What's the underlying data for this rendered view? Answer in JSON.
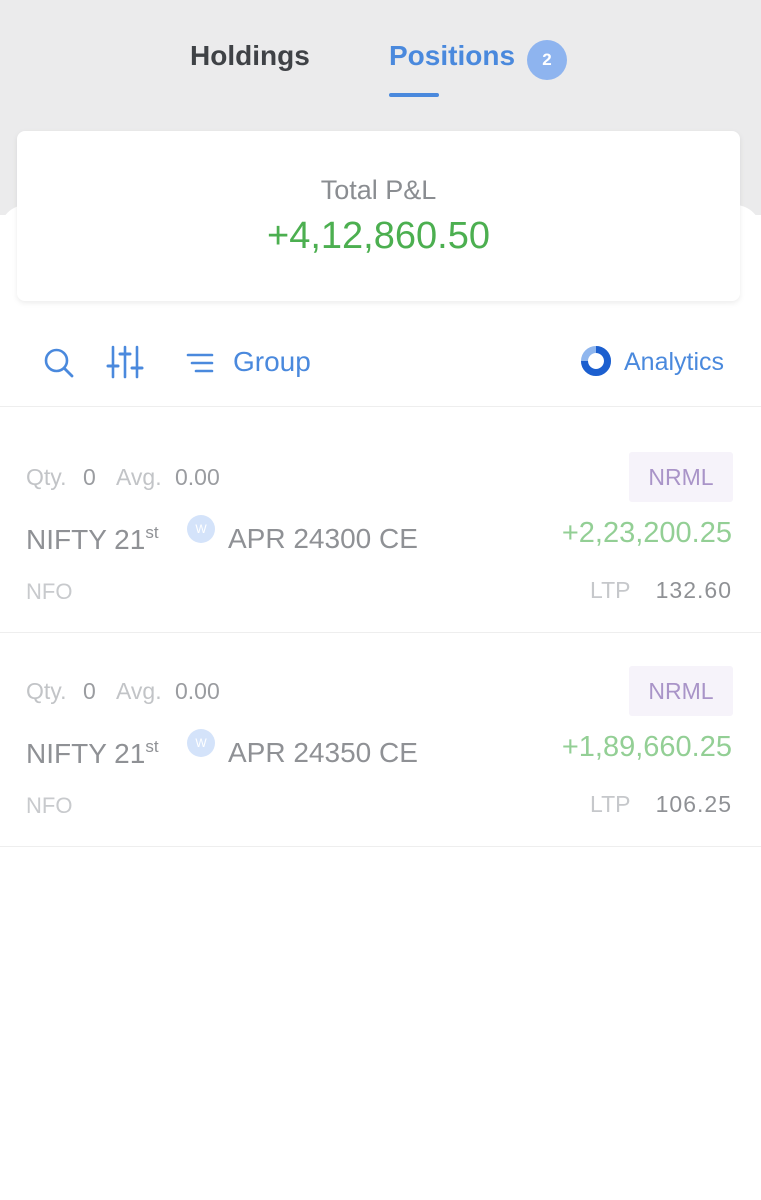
{
  "tabs": {
    "holdings_label": "Holdings",
    "positions_label": "Positions",
    "positions_count": "2"
  },
  "summary": {
    "label": "Total P&L",
    "value": "+4,12,860.50"
  },
  "toolbar": {
    "search_icon": "search-icon",
    "filter_icon": "sliders-icon",
    "group_icon": "group-lines-icon",
    "group_label": "Group",
    "analytics_icon": "analytics-ring-icon",
    "analytics_label": "Analytics"
  },
  "positions": [
    {
      "qty_label": "Qty.",
      "qty": "0",
      "avg_label": "Avg.",
      "avg": "0.00",
      "product": "NRML",
      "symbol": "NIFTY 21",
      "date_suffix": "st",
      "weekly_badge": "W",
      "contract": "APR 24300 CE",
      "pnl": "+2,23,200.25",
      "exchange": "NFO",
      "ltp_label": "LTP",
      "ltp": "132.60"
    },
    {
      "qty_label": "Qty.",
      "qty": "0",
      "avg_label": "Avg.",
      "avg": "0.00",
      "product": "NRML",
      "symbol": "NIFTY 21",
      "date_suffix": "st",
      "weekly_badge": "W",
      "contract": "APR 24350 CE",
      "pnl": "+1,89,660.25",
      "exchange": "NFO",
      "ltp_label": "LTP",
      "ltp": "106.25"
    }
  ],
  "colors": {
    "accent": "#4a89dd",
    "profit": "#4caf50",
    "product_tag": "#a994c8"
  }
}
